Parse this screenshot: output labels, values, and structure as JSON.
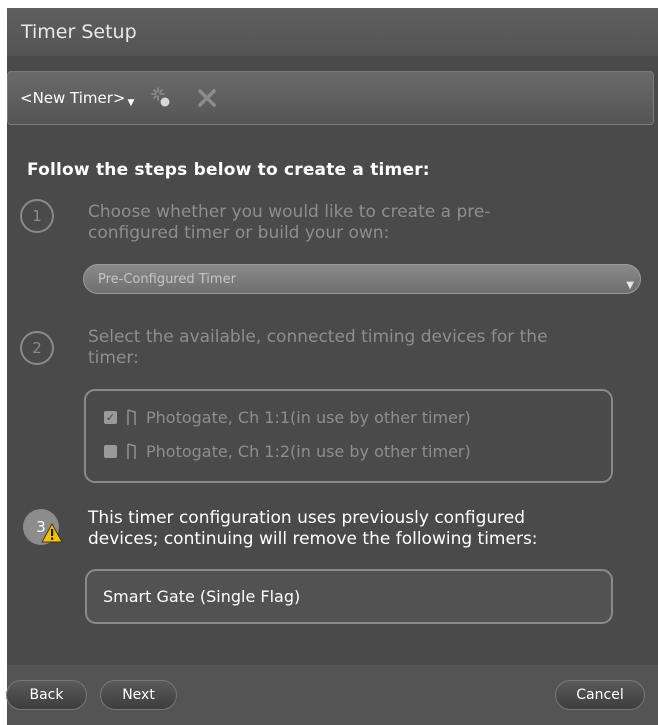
{
  "window": {
    "title": "Timer Setup"
  },
  "toolbar": {
    "timer_select_label": "<New Timer>",
    "new_icon": "sparkle-new-icon",
    "delete_icon": "close-x-icon"
  },
  "instructions": {
    "heading": "Follow the steps below to create a timer:"
  },
  "step1": {
    "number": "1",
    "text_line1": "Choose whether you would like to create a pre-",
    "text_line2": "configured timer or build your own:",
    "dropdown_value": "Pre-Configured Timer"
  },
  "step2": {
    "number": "2",
    "text_line1": "Select the available, connected timing devices for the",
    "text_line2": "timer:",
    "devices": [
      {
        "label": "Photogate, Ch 1:1(in use by other timer)",
        "checked": true
      },
      {
        "label": "Photogate, Ch 1:2(in use by other timer)",
        "checked": false
      }
    ]
  },
  "step3": {
    "number": "3",
    "text_line1": "This timer configuration uses previously configured",
    "text_line2": "devices; continuing will remove the following timers:",
    "removed_timer": "Smart Gate (Single Flag)"
  },
  "footer": {
    "back_label": "Back",
    "next_label": "Next",
    "cancel_label": "Cancel"
  },
  "colors": {
    "background": "#4a4a4a",
    "disabled_text": "#8e8e8e",
    "active_text": "#ffffff",
    "warning": "#f0c020"
  }
}
